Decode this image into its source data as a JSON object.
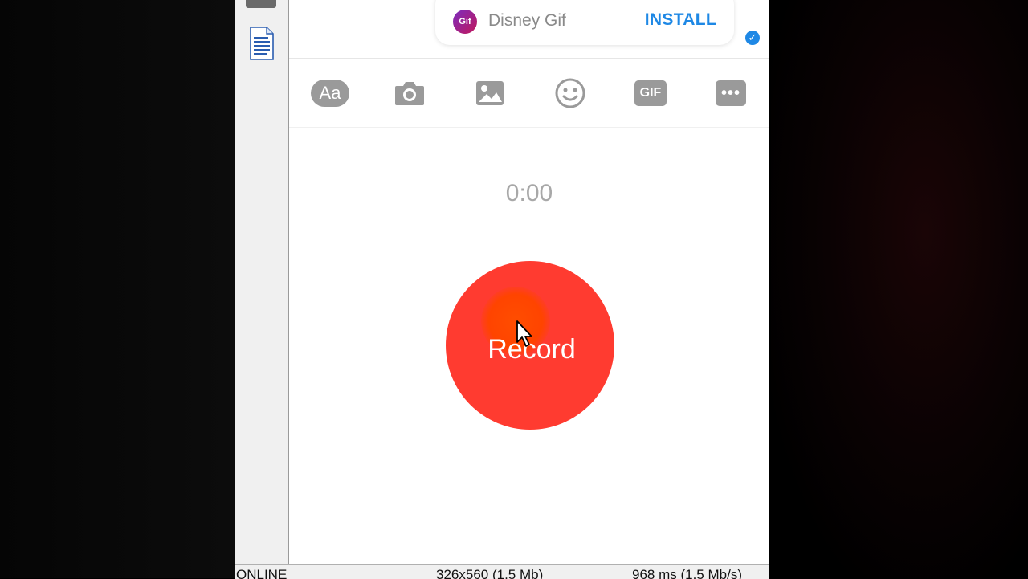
{
  "ad": {
    "logo_text": "Gif",
    "title": "Disney Gif",
    "install_label": "INSTALL"
  },
  "toolbar": {
    "text_label": "Aa",
    "gif_label": "GIF",
    "more_label": "•••",
    "icons": [
      "text-icon",
      "camera-icon",
      "image-icon",
      "emoji-icon",
      "gif-icon",
      "more-icon"
    ]
  },
  "recorder": {
    "timer": "0:00",
    "record_label": "Record"
  },
  "statusbar": {
    "online": "ONLINE",
    "resolution": "326x560 (1.5 Mb)",
    "latency": "968 ms (1.5 Mb/s)"
  },
  "colors": {
    "record": "#ff3b30",
    "accent": "#1e88e5",
    "icon_gray": "#9a9a9a"
  }
}
